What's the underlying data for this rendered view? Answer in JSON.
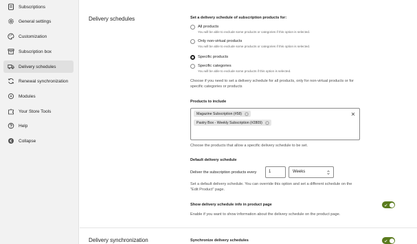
{
  "sidebar": {
    "items": [
      {
        "label": "Subscriptions",
        "icon": "subscriptions-icon"
      },
      {
        "label": "General settings",
        "icon": "gear-icon"
      },
      {
        "label": "Customization",
        "icon": "palette-icon"
      },
      {
        "label": "Subscription box",
        "icon": "box-icon"
      },
      {
        "label": "Delivery schedules",
        "icon": "truck-icon",
        "active": true
      },
      {
        "label": "Renewal synchronization",
        "icon": "sync-icon"
      },
      {
        "label": "Modules",
        "icon": "modules-icon"
      },
      {
        "label": "Your Store Tools",
        "icon": "puzzle-icon"
      },
      {
        "label": "Help",
        "icon": "help-icon"
      },
      {
        "label": "Collapse",
        "icon": "collapse-icon"
      }
    ]
  },
  "delivery_schedules": {
    "section_title": "Delivery schedules",
    "set_schedule": {
      "title": "Set a delivery schedule of subscription products for:",
      "selected": "Specific products",
      "options": [
        {
          "label": "All products",
          "help": "You will be able to exclude some products or categories if this option is selected."
        },
        {
          "label": "Only non-virtual products",
          "help": "You will be able to exclude some products or categories if this option is selected."
        },
        {
          "label": "Specific products",
          "help": ""
        },
        {
          "label": "Specific categories",
          "help": "You will be able to exclude some products if this option is selected."
        }
      ],
      "description_line1": "Choose if you need to set a delivery schedule for all products, only for non-virtual products or for",
      "description_line2": "specific categories or products"
    },
    "products_to_include": {
      "title": "Products to include",
      "tokens": [
        "Magazine Subscription (#58)",
        "Pastry Box - Weekly Subscription (#2809)"
      ],
      "description": "Choose the products that allow a specific delivery schedule to be set."
    },
    "default_schedule": {
      "title": "Default delivery schedule",
      "prefix_label": "Deliver the subscription products every",
      "interval_value": "1",
      "period_value": "Weeks",
      "description_line1": "Set a default delivery schedule. You can override this option and set a different schedule on the",
      "description_line2": "\"Edit Product\" page."
    },
    "show_info": {
      "title": "Show delivery schedule info in product page",
      "enabled": true,
      "description": "Enable if you want to show information about the delivery schedule on the product page."
    }
  },
  "delivery_synchronization": {
    "section_title": "Delivery synchronization",
    "sync": {
      "title": "Synchronize delivery schedules",
      "enabled": true
    }
  },
  "colors": {
    "toggle_on": "#5a7b1e",
    "sidebar_bg": "#f2f2f2",
    "active_item_bg": "#e0e0e0"
  }
}
